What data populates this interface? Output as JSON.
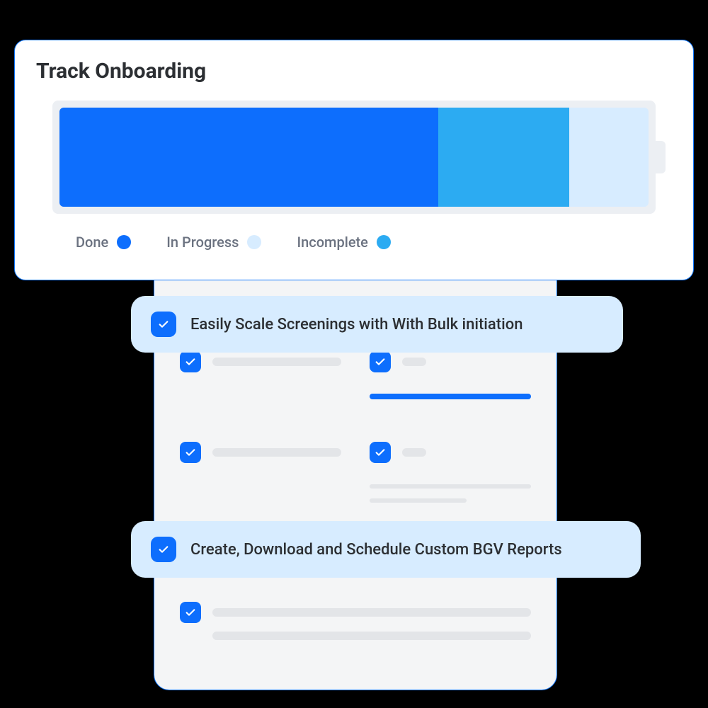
{
  "track": {
    "title": "Track Onboarding",
    "legend": {
      "done": "Done",
      "in_progress": "In Progress",
      "incomplete": "Incomplete"
    }
  },
  "callouts": [
    {
      "label": "Easily Scale Screenings with With Bulk initiation"
    },
    {
      "label": "Create, Download and Schedule Custom BGV Reports"
    }
  ]
}
